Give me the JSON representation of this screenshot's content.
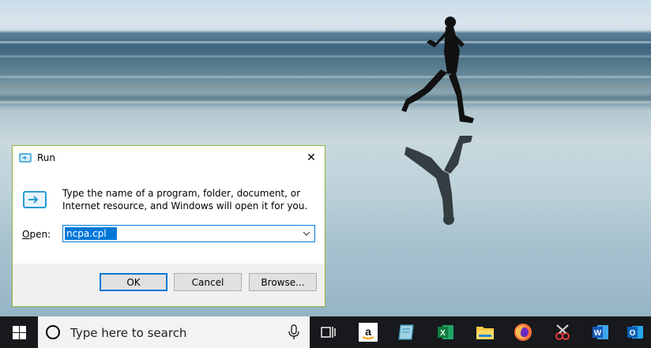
{
  "run_dialog": {
    "title": "Run",
    "close_symbol": "✕",
    "description": "Type the name of a program, folder, document, or Internet resource, and Windows will open it for you.",
    "open_label_first": "O",
    "open_label_rest": "pen:",
    "open_value": "ncpa.cpl",
    "buttons": {
      "ok": "OK",
      "cancel": "Cancel",
      "browse": "Browse..."
    }
  },
  "taskbar": {
    "search_placeholder": "Type here to search",
    "icons": [
      "windows-start-icon",
      "cortana-circle-icon",
      "microphone-icon",
      "task-view-icon",
      "amazon-icon",
      "notepad-app-icon",
      "excel-icon",
      "file-explorer-icon",
      "firefox-icon",
      "snipping-tool-icon",
      "word-icon",
      "outlook-icon"
    ]
  },
  "colors": {
    "accent": "#0078d7",
    "dialog_border": "#8fb43a",
    "taskbar_bg": "#17191c",
    "search_bg": "#f3f3f3"
  }
}
